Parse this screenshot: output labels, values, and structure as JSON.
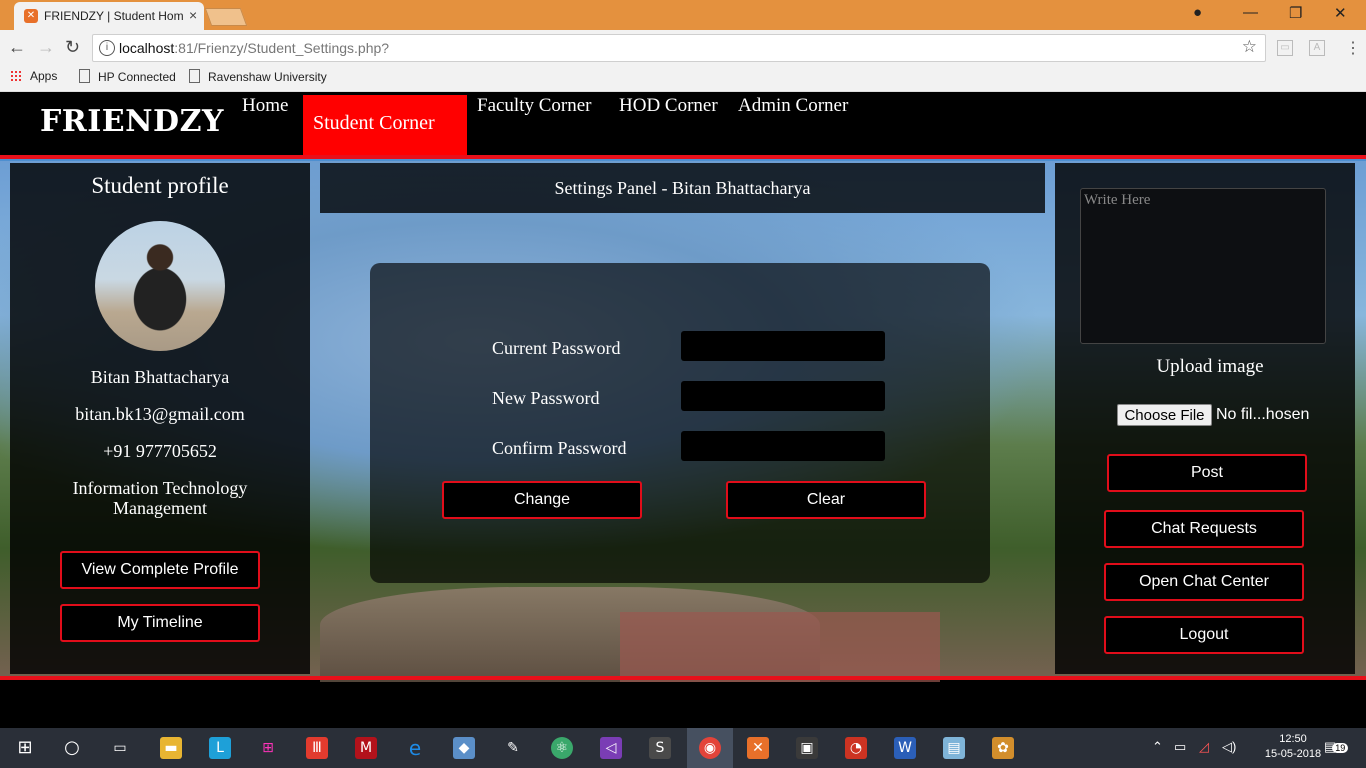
{
  "browser": {
    "tab_title": "FRIENDZY | Student Hom",
    "url_host": "localhost",
    "url_rest": ":81/Frienzy/Student_Settings.php?",
    "bookmarks": [
      "Apps",
      "HP Connected",
      "Ravenshaw University"
    ]
  },
  "site": {
    "logo": "FRIENDZY",
    "nav": {
      "home": "Home",
      "student": "Student Corner",
      "faculty": "Faculty Corner",
      "hod": "HOD Corner",
      "admin": "Admin Corner"
    }
  },
  "profile": {
    "title": "Student profile",
    "name": "Bitan Bhattacharya",
    "email": "bitan.bk13@gmail.com",
    "phone": "+91 977705652",
    "dept_line1": "Information Technology",
    "dept_line2": "Management",
    "view_profile_label": "View Complete Profile",
    "timeline_label": "My Timeline"
  },
  "settings": {
    "heading": "Settings Panel - Bitan Bhattacharya",
    "current_password_label": "Current Password",
    "new_password_label": "New Password",
    "confirm_password_label": "Confirm Password",
    "change_label": "Change",
    "clear_label": "Clear"
  },
  "sidebar": {
    "write_placeholder": "Write Here",
    "upload_label": "Upload image",
    "choose_file_label": "Choose File",
    "file_name": "No fil...hosen",
    "post_label": "Post",
    "chat_requests_label": "Chat Requests",
    "chat_center_label": "Open Chat Center",
    "logout_label": "Logout"
  },
  "taskbar": {
    "time": "12:50",
    "date": "15-05-2018",
    "notification_count": "19"
  }
}
